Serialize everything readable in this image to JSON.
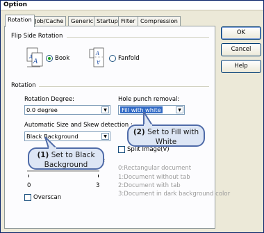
{
  "window": {
    "title": "Option"
  },
  "tabs": [
    {
      "label": "Rotation"
    },
    {
      "label": "Job/Cache"
    },
    {
      "label": "Generic"
    },
    {
      "label": "Startup"
    },
    {
      "label": "Filter"
    },
    {
      "label": "Compression"
    }
  ],
  "buttons": {
    "ok": "OK",
    "cancel": "Cancel",
    "help": "Help"
  },
  "flip_side": {
    "group_title": "Flip Side Rotation",
    "book_label": "Book",
    "fanfold_label": "Fanfold",
    "selected": "Book"
  },
  "rotation": {
    "group_title": "Rotation",
    "degree_label": "Rotation Degree:",
    "degree_value": "0.0 degree",
    "hole_punch_label": "Hole punch removal:",
    "hole_punch_value": "Fill with white",
    "auto_size_label": "Automatic Size and Skew detection :",
    "auto_size_value": "Black Background",
    "split_image_label": "Split Image(V)",
    "overscan_label": "Overscan",
    "slider_min": "0",
    "slider_max": "3",
    "tab_options": [
      "0:Rectangular document",
      "1:Document without tab",
      "2:Document with tab",
      "3:Document in dark background color"
    ]
  },
  "callouts": {
    "one_num": "(1)",
    "one_text_a": "Set to Black",
    "one_text_b": "Background",
    "two_num": "(2)",
    "two_text_a": "Set to Fill with",
    "two_text_b": "White"
  },
  "colors": {
    "selection": "#316ac5",
    "callout_fill": "#dde6f5",
    "callout_border": "#4f6ba8"
  }
}
